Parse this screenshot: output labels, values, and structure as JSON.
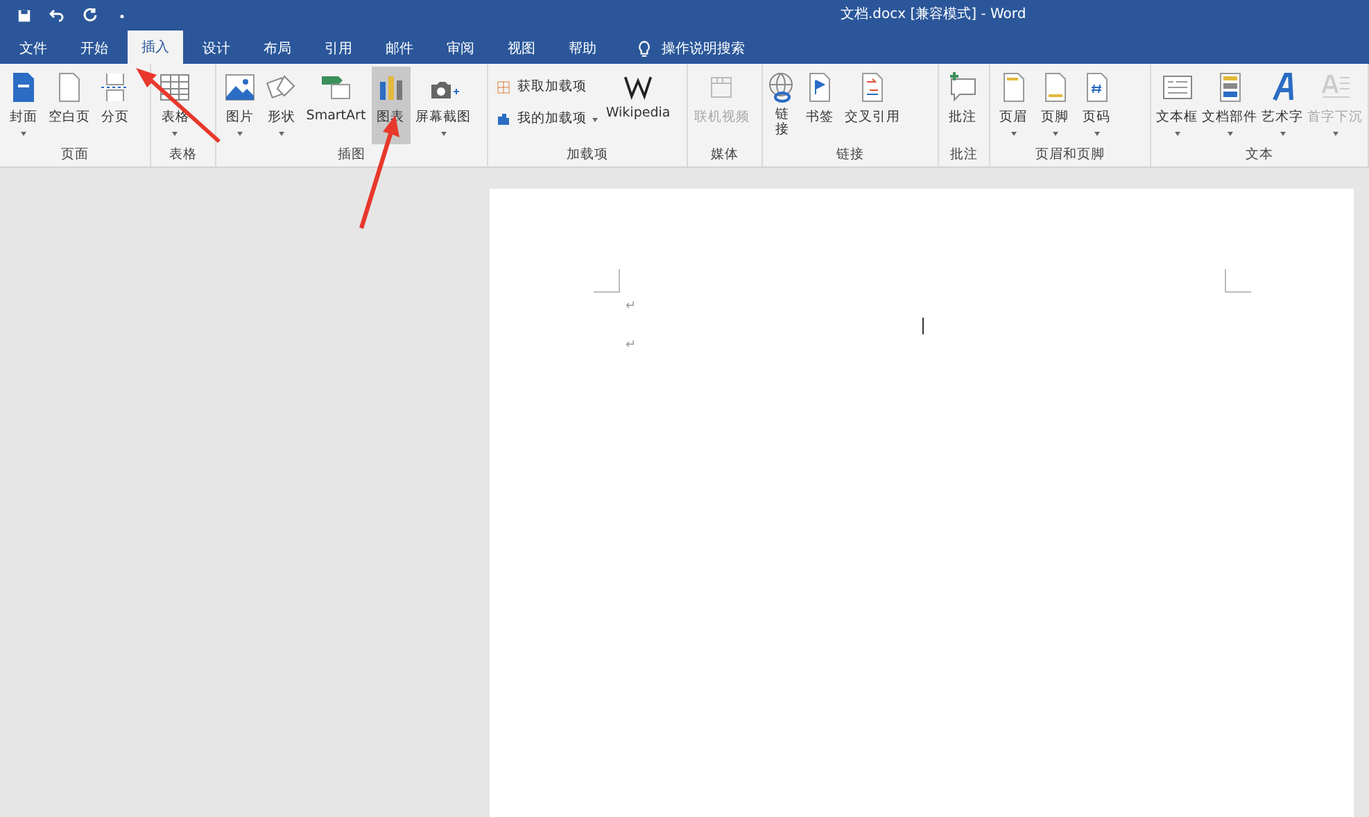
{
  "window": {
    "title": "文档.docx [兼容模式]  -  Word"
  },
  "tabs": [
    {
      "label": "文件",
      "selected": false
    },
    {
      "label": "开始",
      "selected": false
    },
    {
      "label": "插入",
      "selected": true
    },
    {
      "label": "设计",
      "selected": false
    },
    {
      "label": "布局",
      "selected": false
    },
    {
      "label": "引用",
      "selected": false
    },
    {
      "label": "邮件",
      "selected": false
    },
    {
      "label": "审阅",
      "selected": false
    },
    {
      "label": "视图",
      "selected": false
    },
    {
      "label": "帮助",
      "selected": false
    }
  ],
  "search": {
    "label": "操作说明搜索"
  },
  "ribbon_groups": [
    {
      "label": "页面",
      "buttons": [
        {
          "kind": "large",
          "label": "封面",
          "dropdown": true,
          "disabled": false,
          "selected": false
        },
        {
          "kind": "large",
          "label": "空白页",
          "dropdown": false,
          "disabled": false,
          "selected": false
        },
        {
          "kind": "large",
          "label": "分页",
          "dropdown": false,
          "disabled": false,
          "selected": false
        }
      ]
    },
    {
      "label": "表格",
      "buttons": [
        {
          "kind": "large",
          "label": "表格",
          "dropdown": true,
          "disabled": false,
          "selected": false
        }
      ]
    },
    {
      "label": "插图",
      "buttons": [
        {
          "kind": "large",
          "label": "图片",
          "dropdown": true,
          "disabled": false,
          "selected": false
        },
        {
          "kind": "large",
          "label": "形状",
          "dropdown": true,
          "disabled": false,
          "selected": false
        },
        {
          "kind": "large",
          "label": "SmartArt",
          "dropdown": false,
          "disabled": false,
          "selected": false
        },
        {
          "kind": "large",
          "label": "图表",
          "dropdown": false,
          "disabled": false,
          "selected": true
        },
        {
          "kind": "large",
          "label": "屏幕截图",
          "dropdown": true,
          "disabled": false,
          "selected": false
        }
      ]
    },
    {
      "label": "加载项",
      "buttons": [
        {
          "kind": "small",
          "label": "获取加载项",
          "dropdown": false,
          "disabled": false,
          "selected": false
        },
        {
          "kind": "small",
          "label": "我的加载项",
          "dropdown": true,
          "disabled": false,
          "selected": false
        },
        {
          "kind": "large",
          "label": "Wikipedia",
          "dropdown": false,
          "disabled": false,
          "selected": false
        }
      ]
    },
    {
      "label": "媒体",
      "buttons": [
        {
          "kind": "large",
          "label": "联机视频",
          "dropdown": false,
          "disabled": true,
          "selected": false
        }
      ]
    },
    {
      "label": "链接",
      "buttons": [
        {
          "kind": "large",
          "label": "链接",
          "dropdown": false,
          "disabled": false,
          "selected": false
        },
        {
          "kind": "large",
          "label": "书签",
          "dropdown": false,
          "disabled": false,
          "selected": false
        },
        {
          "kind": "large",
          "label": "交叉引用",
          "dropdown": false,
          "disabled": false,
          "selected": false
        }
      ]
    },
    {
      "label": "批注",
      "buttons": [
        {
          "kind": "large",
          "label": "批注",
          "dropdown": false,
          "disabled": false,
          "selected": false
        }
      ]
    },
    {
      "label": "页眉和页脚",
      "buttons": [
        {
          "kind": "large",
          "label": "页眉",
          "dropdown": true,
          "disabled": false,
          "selected": false
        },
        {
          "kind": "large",
          "label": "页脚",
          "dropdown": true,
          "disabled": false,
          "selected": false
        },
        {
          "kind": "large",
          "label": "页码",
          "dropdown": true,
          "disabled": false,
          "selected": false
        }
      ]
    },
    {
      "label": "文本",
      "buttons": [
        {
          "kind": "large",
          "label": "文本框",
          "dropdown": true,
          "disabled": false,
          "selected": false
        },
        {
          "kind": "large",
          "label": "文档部件",
          "dropdown": true,
          "disabled": false,
          "selected": false
        },
        {
          "kind": "large",
          "label": "艺术字",
          "dropdown": true,
          "disabled": false,
          "selected": false
        },
        {
          "kind": "large",
          "label": "首字下沉",
          "dropdown": true,
          "disabled": true,
          "selected": false
        }
      ]
    }
  ],
  "document": {
    "paragraph_marks": [
      "↵",
      "↵"
    ]
  }
}
